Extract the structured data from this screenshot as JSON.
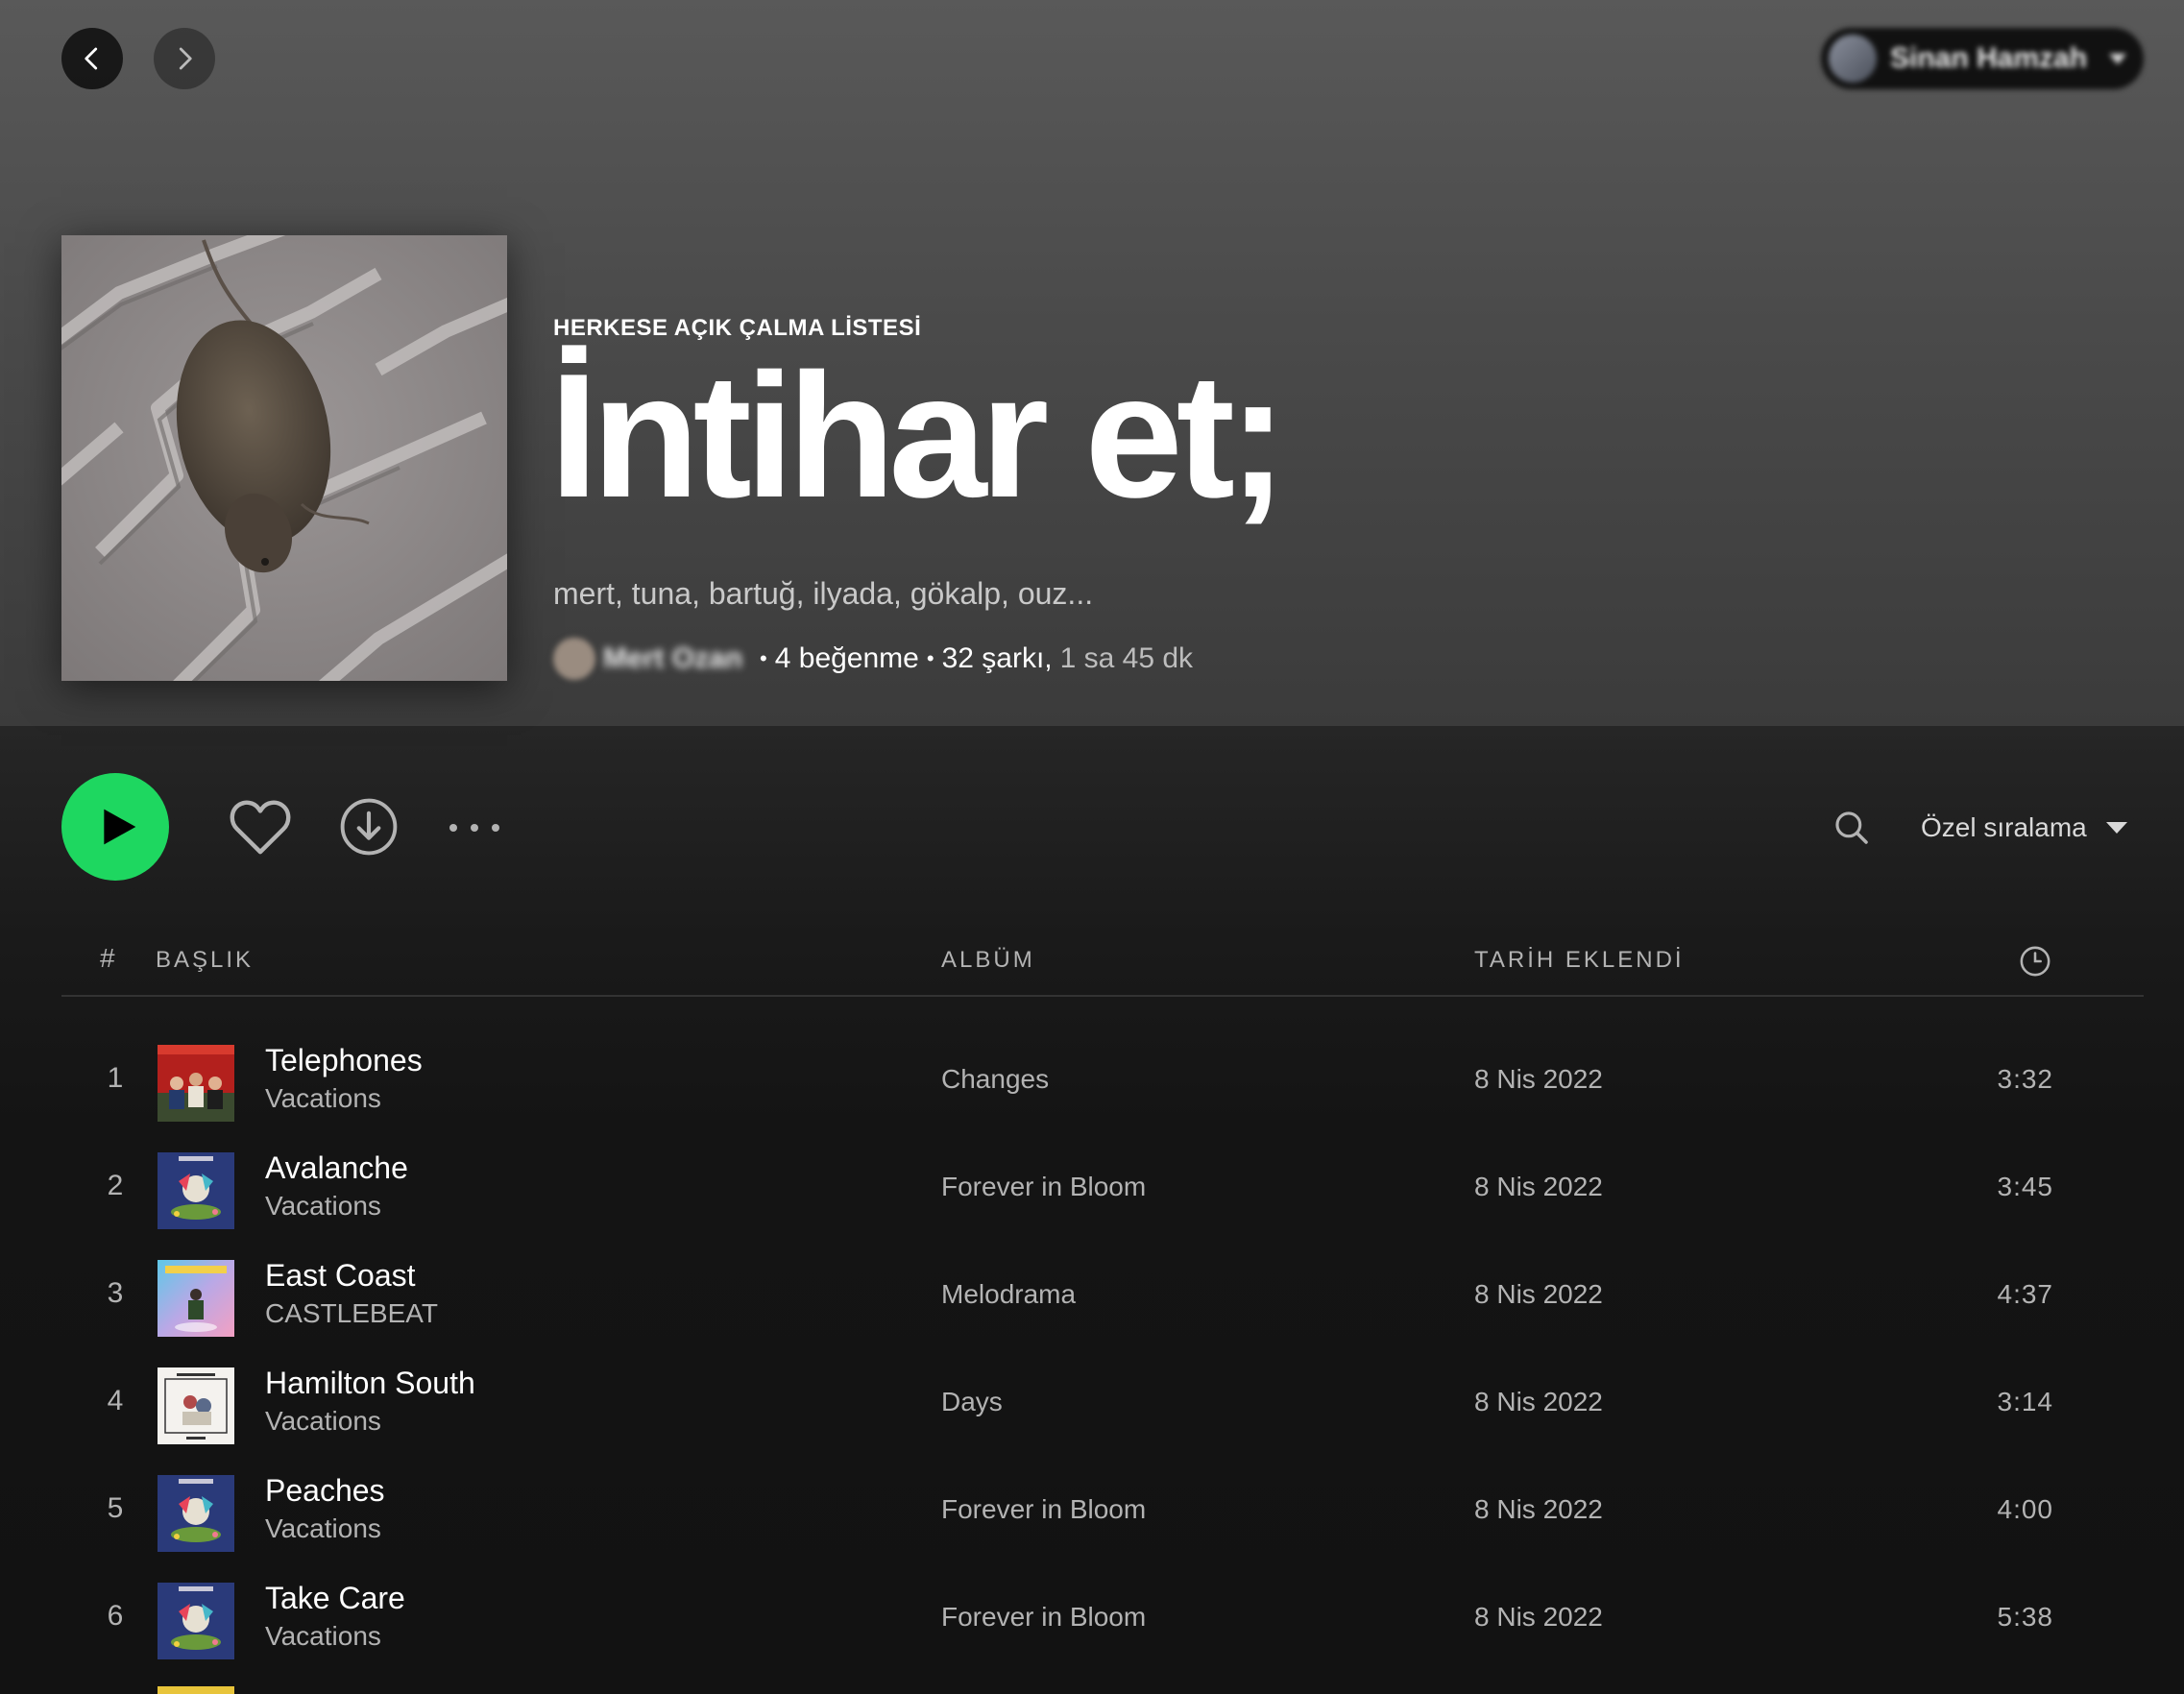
{
  "nav": {
    "back_icon": "chevron-left-icon",
    "forward_icon": "chevron-right-icon"
  },
  "user": {
    "name": "Sinan Hamzah"
  },
  "playlist": {
    "type_label": "HERKESE AÇIK ÇALMA LİSTESİ",
    "title": "İntihar et;",
    "description": "mert, tuna, bartuğ, ilyada, gökalp, ouz...",
    "owner": "Mert Ozan",
    "likes": "4 beğenme",
    "songs": "32 şarkı,",
    "duration": "1 sa 45 dk",
    "separator": "•"
  },
  "actions": {
    "sort_label": "Özel sıralama",
    "accent_color": "#1ed760"
  },
  "table": {
    "headers": {
      "num": "#",
      "title": "BAŞLIK",
      "album": "ALBÜM",
      "date": "TARİH EKLENDİ",
      "duration_icon": "clock-icon"
    },
    "rows": [
      {
        "num": "1",
        "title": "Telephones",
        "artist": "Vacations",
        "album": "Changes",
        "date": "8 Nis 2022",
        "duration": "3:32"
      },
      {
        "num": "2",
        "title": "Avalanche",
        "artist": "Vacations",
        "album": "Forever in Bloom",
        "date": "8 Nis 2022",
        "duration": "3:45"
      },
      {
        "num": "3",
        "title": "East Coast",
        "artist": "CASTLEBEAT",
        "album": "Melodrama",
        "date": "8 Nis 2022",
        "duration": "4:37"
      },
      {
        "num": "4",
        "title": "Hamilton South",
        "artist": "Vacations",
        "album": "Days",
        "date": "8 Nis 2022",
        "duration": "3:14"
      },
      {
        "num": "5",
        "title": "Peaches",
        "artist": "Vacations",
        "album": "Forever in Bloom",
        "date": "8 Nis 2022",
        "duration": "4:00"
      },
      {
        "num": "6",
        "title": "Take Care",
        "artist": "Vacations",
        "album": "Forever in Bloom",
        "date": "8 Nis 2022",
        "duration": "5:38"
      }
    ]
  }
}
